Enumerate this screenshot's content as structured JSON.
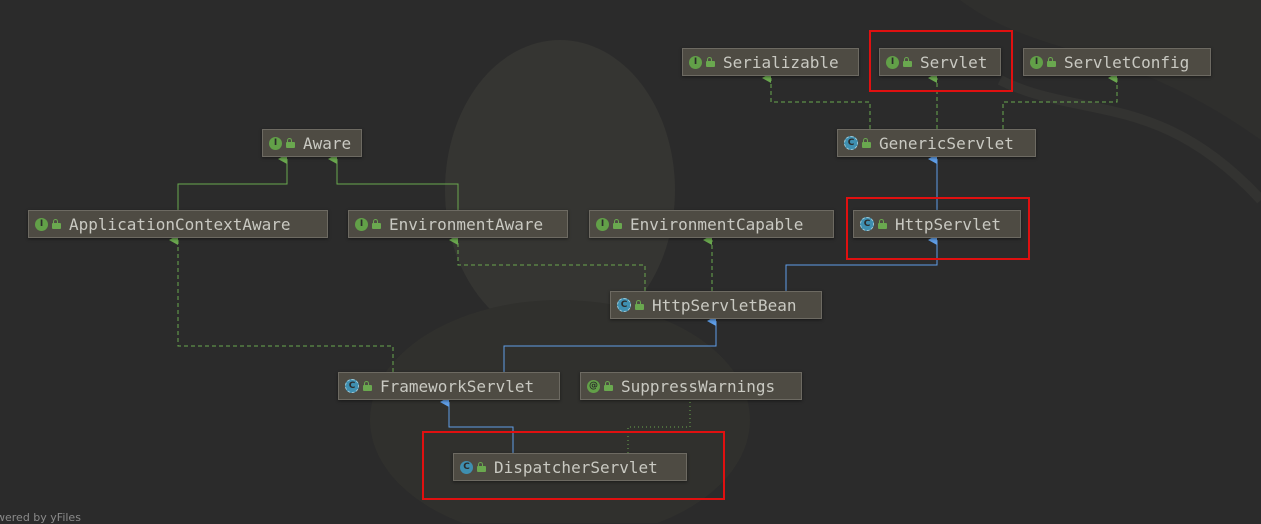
{
  "nodes": {
    "serializable": {
      "label": "Serializable",
      "kind": "I"
    },
    "servlet": {
      "label": "Servlet",
      "kind": "I"
    },
    "servlet_config": {
      "label": "ServletConfig",
      "kind": "I"
    },
    "aware": {
      "label": "Aware",
      "kind": "I"
    },
    "generic_servlet": {
      "label": "GenericServlet",
      "kind": "A"
    },
    "application_context_aware": {
      "label": "ApplicationContextAware",
      "kind": "I"
    },
    "environment_aware": {
      "label": "EnvironmentAware",
      "kind": "I"
    },
    "environment_capable": {
      "label": "EnvironmentCapable",
      "kind": "I"
    },
    "http_servlet": {
      "label": "HttpServlet",
      "kind": "A"
    },
    "http_servlet_bean": {
      "label": "HttpServletBean",
      "kind": "A"
    },
    "framework_servlet": {
      "label": "FrameworkServlet",
      "kind": "A"
    },
    "suppress_warnings": {
      "label": "SuppressWarnings",
      "kind": "@"
    },
    "dispatcher_servlet": {
      "label": "DispatcherServlet",
      "kind": "C"
    }
  },
  "kind_icons": {
    "I": "I",
    "C": "C",
    "A": "C",
    "@": "@"
  },
  "edge_colors": {
    "extends": "#5f9ee8",
    "implements": "#6aa84f",
    "annotation": "#6aa84f"
  },
  "highlight_color": "#e01010",
  "footer_text": "wered by yFiles"
}
